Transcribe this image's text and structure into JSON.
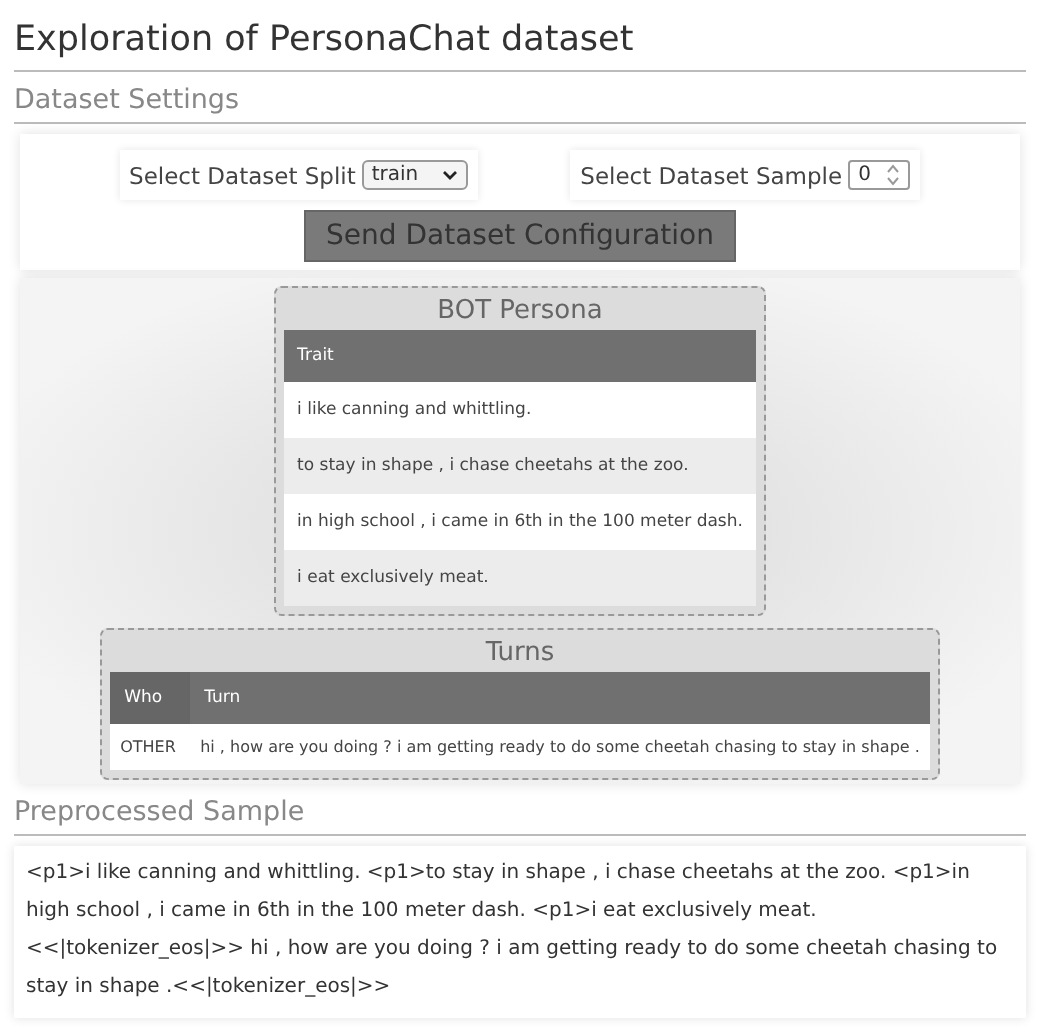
{
  "title": "Exploration of PersonaChat dataset",
  "settings": {
    "heading": "Dataset Settings",
    "split": {
      "label": "Select Dataset Split",
      "value": "train"
    },
    "sample": {
      "label": "Select Dataset Sample",
      "value": "0"
    },
    "button": "Send Dataset Configuration"
  },
  "persona": {
    "title": "BOT Persona",
    "columns": [
      "Trait"
    ],
    "rows": [
      "i like canning and whittling.",
      "to stay in shape , i chase cheetahs at the zoo.",
      "in high school , i came in 6th in the 100 meter dash.",
      "i eat exclusively meat."
    ]
  },
  "turns": {
    "title": "Turns",
    "columns": [
      "Who",
      "Turn"
    ],
    "rows": [
      {
        "who": "OTHER",
        "turn": "hi , how are you doing ? i am getting ready to do some cheetah chasing to stay in shape ."
      }
    ]
  },
  "preprocessed": {
    "heading": "Preprocessed Sample",
    "text": "<p1>i like canning and whittling. <p1>to stay in shape , i chase cheetahs at the zoo. <p1>in high school , i came in 6th in the 100 meter dash. <p1>i eat exclusively meat. <<|tokenizer_eos|>> hi , how are you doing ? i am getting ready to do some cheetah chasing to stay in shape .<<|tokenizer_eos|>>"
  }
}
